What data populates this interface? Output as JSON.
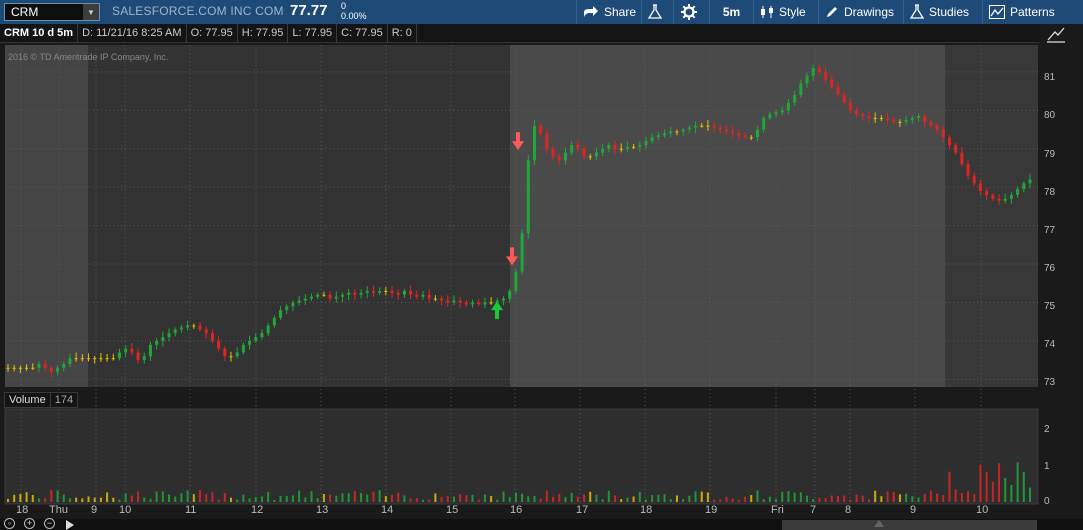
{
  "toolbar": {
    "symbol": "CRM",
    "company": "SALESFORCE.COM INC COM",
    "last": "77.77",
    "change": "0",
    "change_pct": "0.00%",
    "share_label": "Share",
    "interval_label": "5m",
    "style_label": "Style",
    "drawings_label": "Drawings",
    "studies_label": "Studies",
    "patterns_label": "Patterns"
  },
  "infobar": {
    "title": "CRM 10 d 5m",
    "date": "D: 11/21/16 8:25 AM",
    "open": "O: 77.95",
    "high": "H: 77.95",
    "low": "L: 77.95",
    "close": "C: 77.95",
    "range": "R: 0"
  },
  "copyright": "2016 © TD Ameritrade IP Company, Inc.",
  "volume": {
    "label": "Volume",
    "value": "174"
  },
  "price_axis": [
    "81",
    "80",
    "79",
    "78",
    "77",
    "76",
    "75",
    "74",
    "73"
  ],
  "volume_axis": [
    "2",
    "1",
    "0"
  ],
  "time_axis": [
    "18",
    "Thu",
    "9",
    "10",
    "11",
    "12",
    "13",
    "14",
    "15",
    "16",
    "17",
    "18",
    "19",
    "Fri",
    "7",
    "8",
    "9",
    "10"
  ],
  "colors": {
    "up": "#1fa83a",
    "down": "#e02424",
    "flat": "#e6c200",
    "arrow_up": "#18c83a",
    "arrow_down": "#ff5a5a",
    "toolbar": "#1e4a78"
  },
  "chart_data": {
    "type": "candlestick",
    "series": [
      {
        "name": "CRM",
        "closes": [
          73.3,
          73.3,
          73.3,
          73.3,
          73.3,
          73.4,
          73.3,
          73.2,
          73.3,
          73.4,
          73.55,
          73.55,
          73.55,
          73.55,
          73.55,
          73.55,
          73.55,
          73.55,
          73.7,
          73.8,
          73.7,
          73.5,
          73.6,
          73.9,
          74.0,
          74.1,
          74.2,
          74.3,
          74.35,
          74.4,
          74.4,
          74.3,
          74.2,
          74.0,
          73.8,
          73.6,
          73.6,
          73.7,
          73.9,
          74.0,
          74.1,
          74.2,
          74.4,
          74.6,
          74.8,
          74.9,
          75.0,
          75.05,
          75.1,
          75.15,
          75.2,
          75.2,
          75.1,
          75.15,
          75.2,
          75.25,
          75.2,
          75.25,
          75.3,
          75.25,
          75.3,
          75.3,
          75.25,
          75.2,
          75.3,
          75.2,
          75.15,
          75.2,
          75.1,
          75.1,
          75.05,
          75.0,
          75.05,
          75.0,
          74.95,
          75.0,
          74.95,
          75.0,
          75.0,
          75.05,
          75.1,
          75.3,
          75.8,
          76.8,
          78.7,
          79.6,
          79.4,
          79.0,
          78.8,
          78.7,
          78.9,
          79.1,
          79.0,
          78.8,
          78.8,
          78.9,
          79.0,
          79.1,
          79.0,
          79.0,
          79.05,
          79.05,
          79.1,
          79.2,
          79.3,
          79.35,
          79.4,
          79.45,
          79.45,
          79.5,
          79.55,
          79.6,
          79.6,
          79.6,
          79.55,
          79.5,
          79.45,
          79.4,
          79.35,
          79.3,
          79.3,
          79.5,
          79.8,
          79.9,
          79.95,
          80.0,
          80.2,
          80.4,
          80.7,
          80.9,
          81.1,
          81.0,
          80.8,
          80.6,
          80.4,
          80.2,
          80.0,
          79.9,
          79.85,
          79.8,
          79.8,
          79.8,
          79.75,
          79.7,
          79.7,
          79.75,
          79.8,
          79.85,
          79.7,
          79.6,
          79.5,
          79.3,
          79.1,
          78.9,
          78.6,
          78.3,
          78.1,
          77.9,
          77.8,
          77.7,
          77.65,
          77.7,
          77.8,
          77.95,
          78.1,
          78.2
        ]
      }
    ],
    "x_labels": [
      "18",
      "Thu",
      "9",
      "10",
      "11",
      "12",
      "13",
      "14",
      "15",
      "16",
      "17",
      "18",
      "19",
      "Fri",
      "7",
      "8",
      "9",
      "10"
    ],
    "y_ticks": [
      73,
      74,
      75,
      76,
      77,
      78,
      79,
      80,
      81
    ],
    "ylim": [
      72.8,
      81.7
    ],
    "volume_ticks": [
      0,
      1,
      2
    ],
    "annotations": [
      {
        "type": "arrow-up",
        "price": 74.8
      },
      {
        "type": "arrow-down",
        "price": 76.2
      },
      {
        "type": "arrow-down",
        "price": 79.2
      }
    ]
  }
}
